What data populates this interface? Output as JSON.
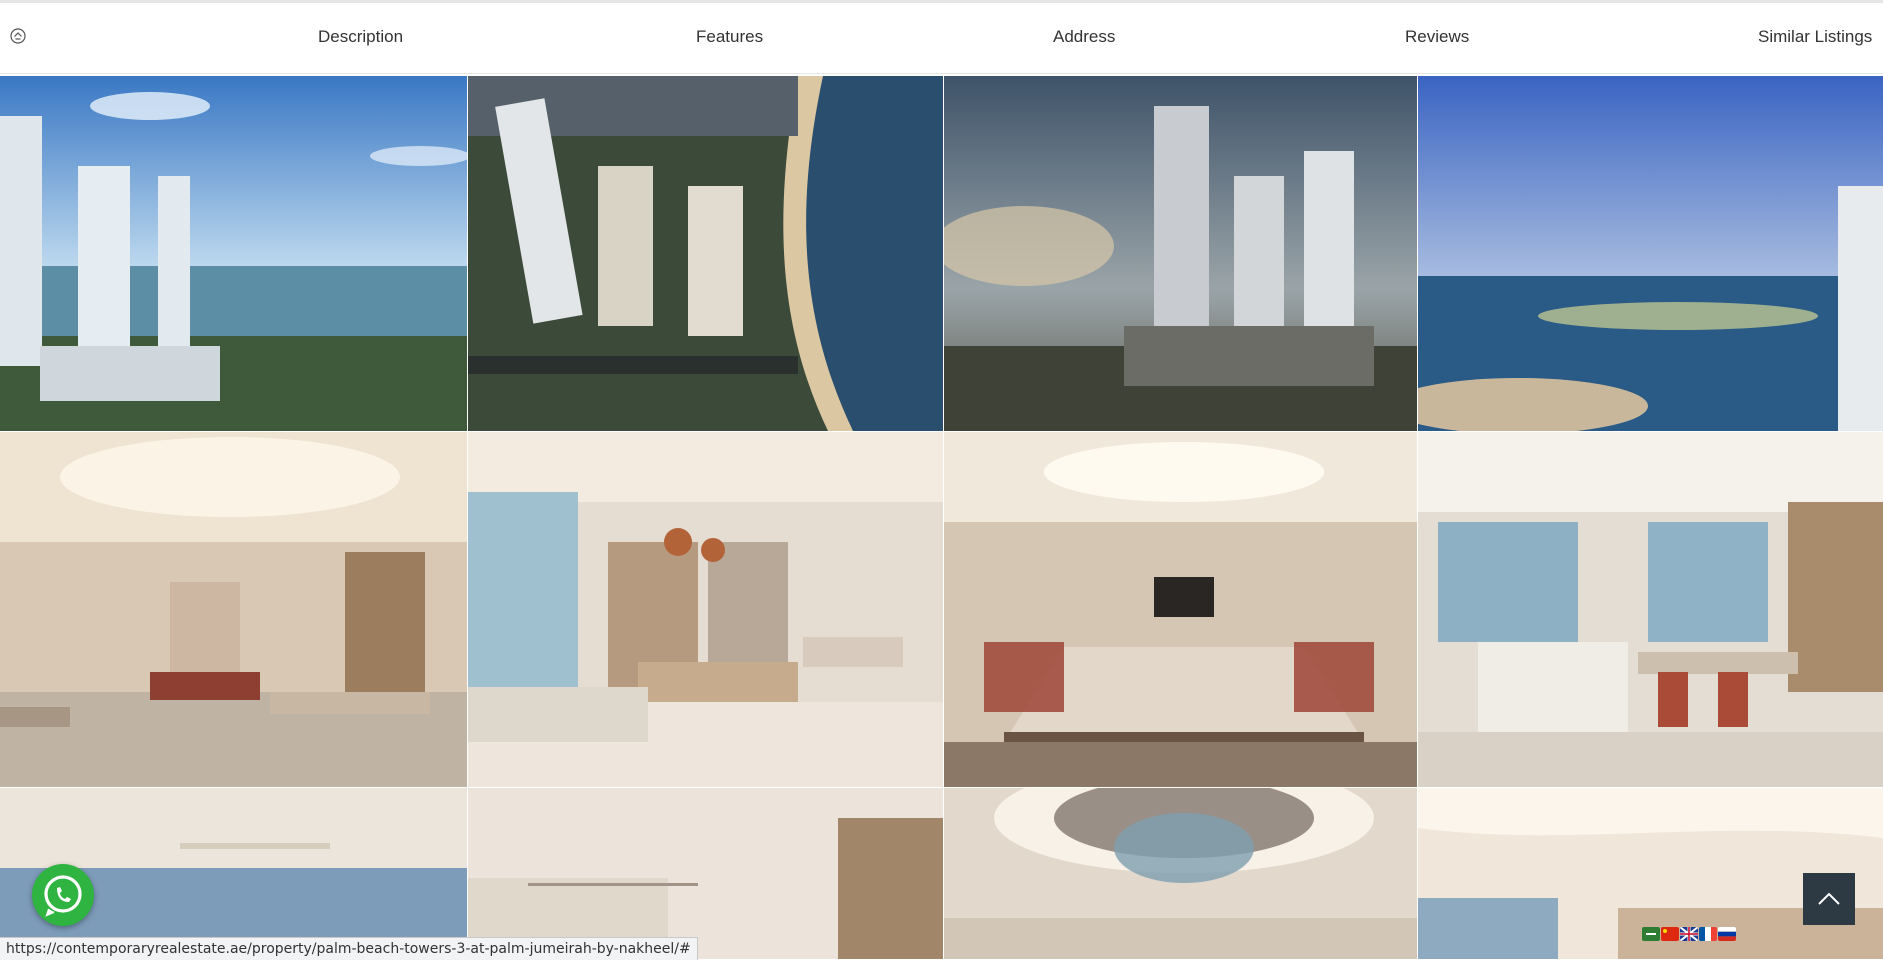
{
  "nav": {
    "items": [
      {
        "label": "Description"
      },
      {
        "label": "Features"
      },
      {
        "label": "Address"
      },
      {
        "label": "Reviews"
      },
      {
        "label": "Similar Listings"
      }
    ],
    "home_icon": "home-circle-icon"
  },
  "gallery": {
    "images": [
      "towers-waterfront-aerial",
      "towers-beach-aerial",
      "towers-sunset",
      "palm-island-sea-view",
      "lounge-interior",
      "games-room-interior",
      "boardroom-interior",
      "dining-kitchen-interior",
      "living-room-interior",
      "hallway-interior",
      "chandelier-lobby-interior",
      "curved-ceiling-interior"
    ]
  },
  "widgets": {
    "whatsapp_icon": "whatsapp-icon",
    "back_to_top_icon": "chevron-up-icon",
    "languages": [
      "ar",
      "zh",
      "en",
      "fr",
      "ru"
    ]
  },
  "status": {
    "url": "https://contemporaryrealestate.ae/property/palm-beach-towers-3-at-palm-jumeirah-by-nakheel/#"
  },
  "colors": {
    "whatsapp": "#2fb341",
    "to_top": "#2d3a44"
  }
}
